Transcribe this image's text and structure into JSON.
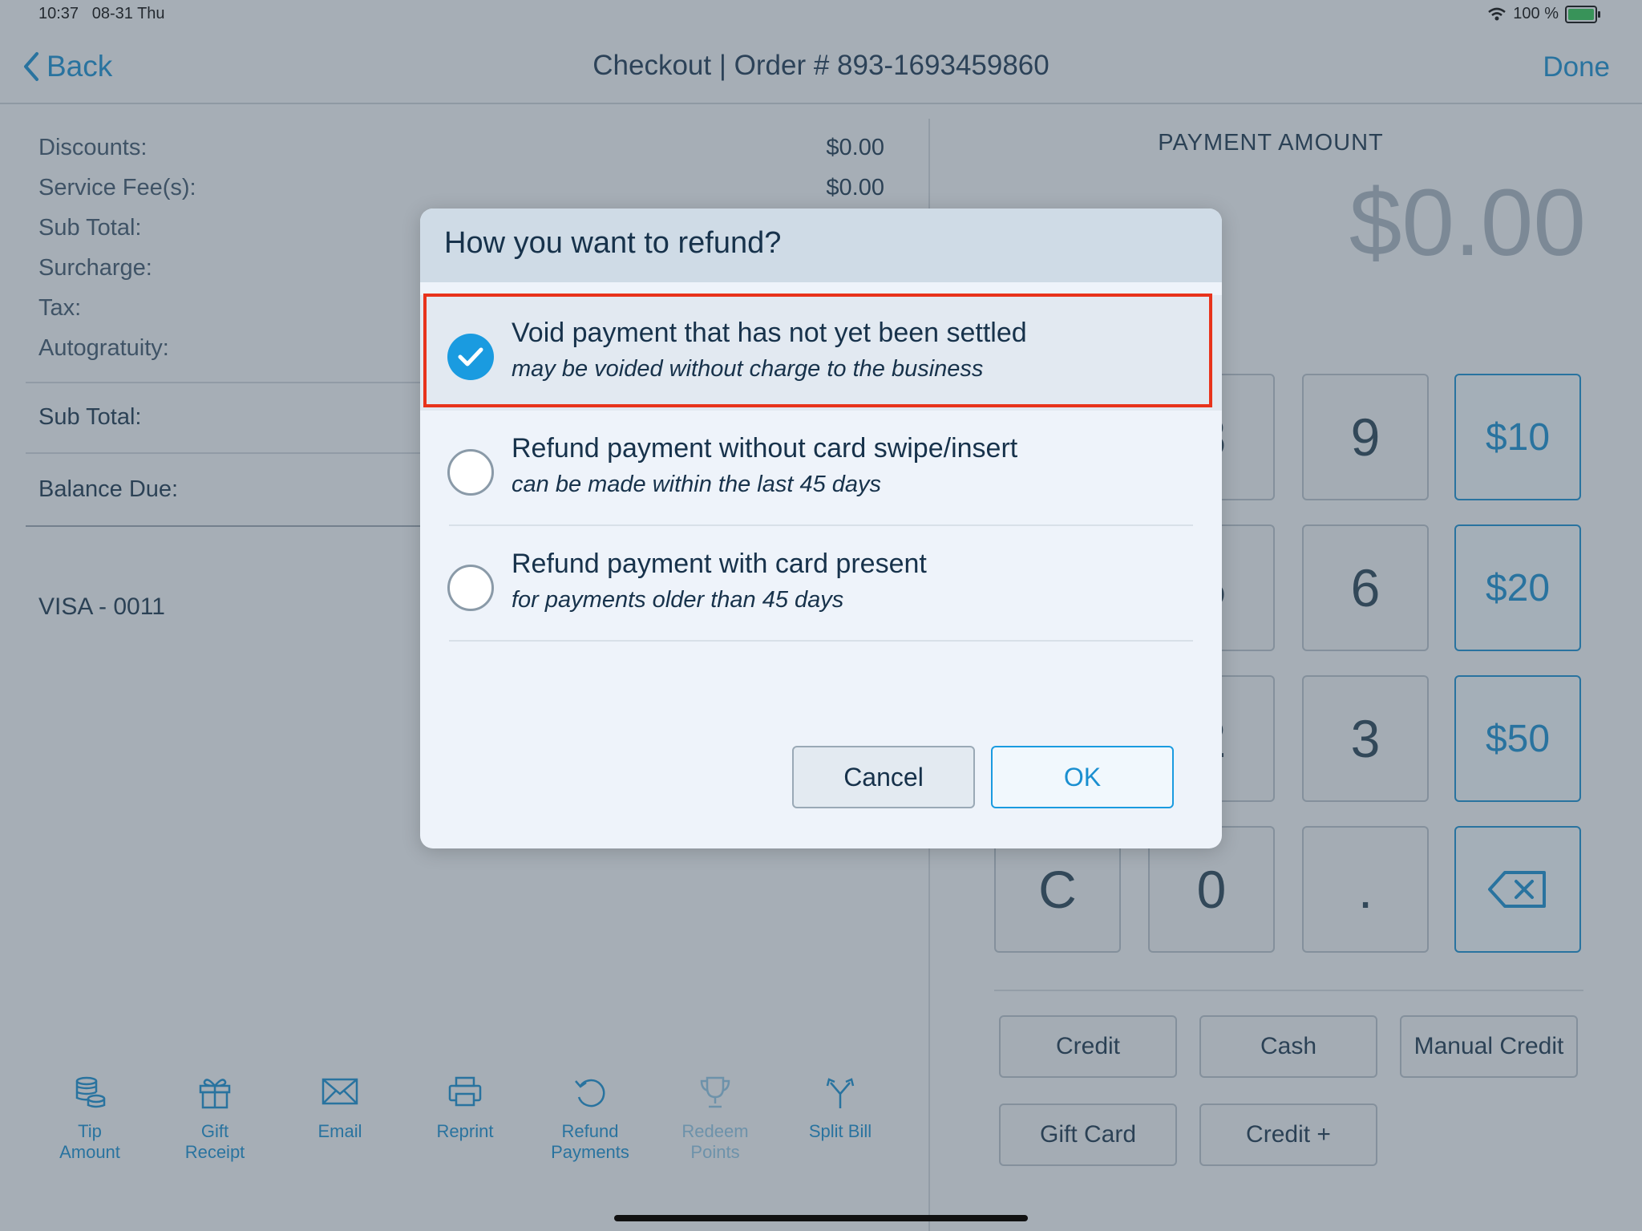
{
  "status_bar": {
    "time": "10:37",
    "date": "08-31 Thu",
    "battery": "100 %"
  },
  "nav": {
    "back_label": "Back",
    "title": "Checkout | Order # 893-1693459860",
    "done_label": "Done"
  },
  "summary": {
    "rows": [
      {
        "label": "Discounts:",
        "value": "$0.00"
      },
      {
        "label": "Service Fee(s):",
        "value": "$0.00"
      },
      {
        "label": "Sub Total:",
        "value": ""
      },
      {
        "label": "Surcharge:",
        "value": ""
      },
      {
        "label": "Tax:",
        "value": ""
      },
      {
        "label": "Autogratuity:",
        "value": ""
      }
    ],
    "subtotal_label": "Sub Total:",
    "balance_label": "Balance Due:",
    "card": "VISA - 0011"
  },
  "payment": {
    "label": "PAYMENT AMOUNT",
    "amount": "$0.00",
    "keys": [
      "8",
      "9",
      "$10",
      "5",
      "6",
      "$20",
      "2",
      "3",
      "$50",
      "C",
      "0",
      "."
    ],
    "methods": [
      "Credit",
      "Cash",
      "Manual Credit",
      "Gift Card",
      "Credit +"
    ]
  },
  "toolbar": {
    "items": [
      {
        "line1": "Tip",
        "line2": "Amount",
        "icon": "coins-icon"
      },
      {
        "line1": "Gift",
        "line2": "Receipt",
        "icon": "gift-icon"
      },
      {
        "line1": "Email",
        "line2": "",
        "icon": "envelope-icon"
      },
      {
        "line1": "Reprint",
        "line2": "",
        "icon": "printer-icon"
      },
      {
        "line1": "Refund",
        "line2": "Payments",
        "icon": "refund-icon"
      },
      {
        "line1": "Redeem",
        "line2": "Points",
        "icon": "trophy-icon"
      },
      {
        "line1": "Split Bill",
        "line2": "",
        "icon": "split-icon"
      }
    ]
  },
  "dialog": {
    "title": "How you want to refund?",
    "options": [
      {
        "title": "Void payment that has not yet been settled",
        "subtitle": "may be voided without charge to the business",
        "checked": true
      },
      {
        "title": "Refund payment without card swipe/insert",
        "subtitle": "can be made within the last 45 days",
        "checked": false
      },
      {
        "title": "Refund payment with card present",
        "subtitle": "for payments older than 45 days",
        "checked": false
      }
    ],
    "cancel_label": "Cancel",
    "ok_label": "OK"
  },
  "colors": {
    "accent": "#1a8fd0",
    "highlight": "#e8331c",
    "text": "#1e3a52"
  }
}
